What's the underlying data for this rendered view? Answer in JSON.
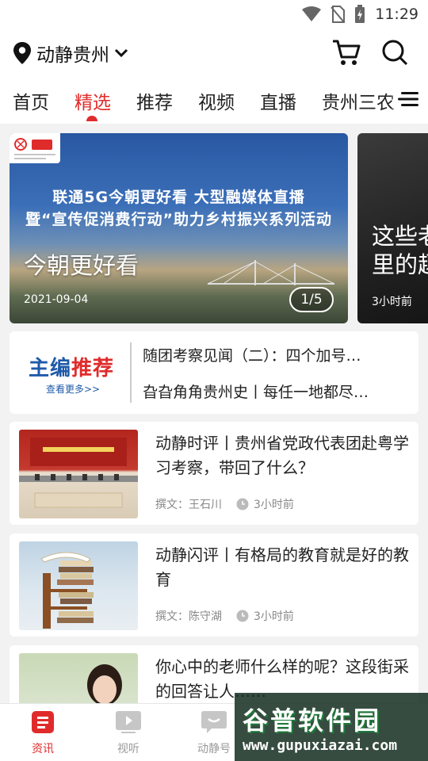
{
  "status_bar": {
    "time": "11:29"
  },
  "header": {
    "location": "动静贵州",
    "icons": {
      "location": "location-pin-icon",
      "dropdown": "chevron-down-icon",
      "cart": "cart-icon",
      "search": "search-icon"
    }
  },
  "tabs": [
    {
      "label": "首页"
    },
    {
      "label": "精选",
      "active": true
    },
    {
      "label": "推荐"
    },
    {
      "label": "视频"
    },
    {
      "label": "直播"
    },
    {
      "label": "贵州三农"
    }
  ],
  "carousel": {
    "main": {
      "line1": "联通5G今朝更好看 大型融媒体直播",
      "line2": "暨“宣传促消费行动”助力乡村振兴系列活动",
      "title": "今朝更好看",
      "date": "2021-09-04",
      "counter": "1/5"
    },
    "next": {
      "title_line1": "这些老",
      "title_line2": "里的趣",
      "time": "3小时前"
    }
  },
  "editor_picks": {
    "brand_left": "主编",
    "brand_right": "推荐",
    "more": "查看更多>>",
    "items": [
      "随团考察见闻（二）：四个加号…",
      "旮旮角角贵州史丨每任一地都尽…"
    ]
  },
  "articles": [
    {
      "title": "动静时评丨贵州省党政代表团赴粤学习考察，带回了什么？",
      "author": "撰文：王石川",
      "time": "3小时前"
    },
    {
      "title": "动静闪评丨有格局的教育就是好的教育",
      "author": "撰文：陈守湖",
      "time": "3小时前"
    },
    {
      "title": "你心中的老师什么样的呢？这段街采的回答让人……",
      "author": "",
      "time": ""
    }
  ],
  "bottom_nav": [
    {
      "label": "资讯",
      "icon": "news-icon",
      "active": true
    },
    {
      "label": "视听",
      "icon": "play-icon"
    },
    {
      "label": "动静号",
      "icon": "chat-icon"
    }
  ],
  "watermark": {
    "text": "谷普软件园",
    "url": "www.gupuxiazai.com"
  },
  "colors": {
    "accent": "#e02b2b",
    "brand_blue": "#1f5aa8"
  }
}
